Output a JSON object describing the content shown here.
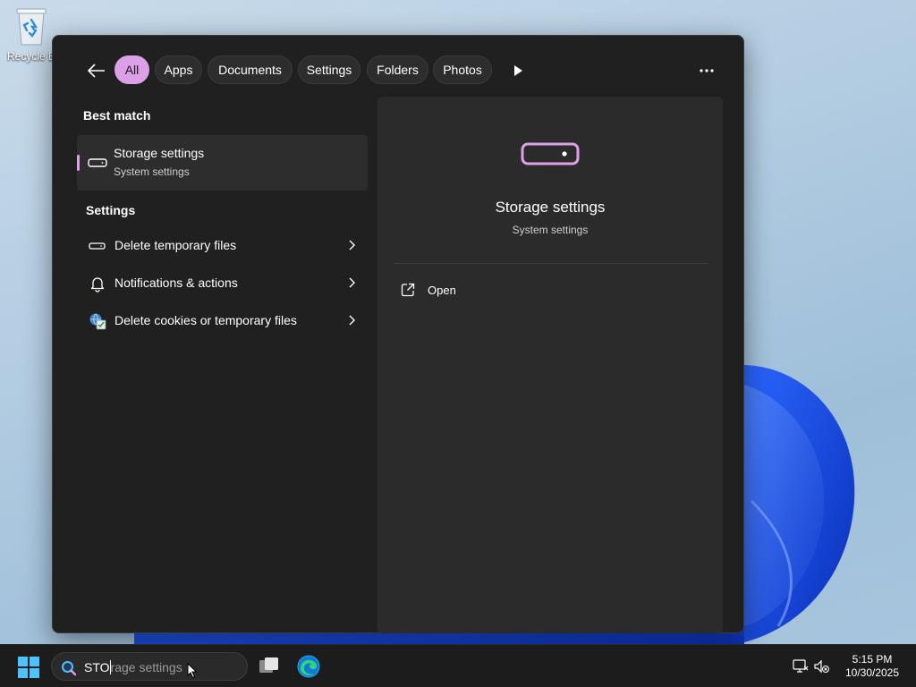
{
  "desktop": {
    "recycle_bin_label": "Recycle Bin"
  },
  "search_panel": {
    "back_icon": "arrow-left-icon",
    "filters": [
      {
        "label": "All",
        "active": true
      },
      {
        "label": "Apps",
        "active": false
      },
      {
        "label": "Documents",
        "active": false
      },
      {
        "label": "Settings",
        "active": false
      },
      {
        "label": "Folders",
        "active": false
      },
      {
        "label": "Photos",
        "active": false
      }
    ],
    "play_icon": "play-icon",
    "more_icon": "more-horizontal-icon",
    "best_match_heading": "Best match",
    "best_match": {
      "title": "Storage settings",
      "subtitle": "System settings",
      "icon": "storage-drive-icon"
    },
    "settings_heading": "Settings",
    "settings_results": [
      {
        "label": "Delete temporary files",
        "icon": "storage-drive-icon"
      },
      {
        "label": "Notifications & actions",
        "icon": "bell-icon"
      },
      {
        "label": "Delete cookies or temporary files",
        "icon": "internet-options-icon"
      }
    ],
    "preview": {
      "title": "Storage settings",
      "subtitle": "System settings",
      "action_open": "Open",
      "open_icon": "open-external-icon"
    }
  },
  "taskbar": {
    "search_typed": "STO",
    "search_suggestion": "rage settings",
    "time": "5:15 PM",
    "date": "10/30/2025"
  },
  "colors": {
    "accent": "#dca0e6",
    "panel_bg": "#202020",
    "preview_bg": "#2b2b2b",
    "taskbar_bg": "#1c1c1c"
  }
}
